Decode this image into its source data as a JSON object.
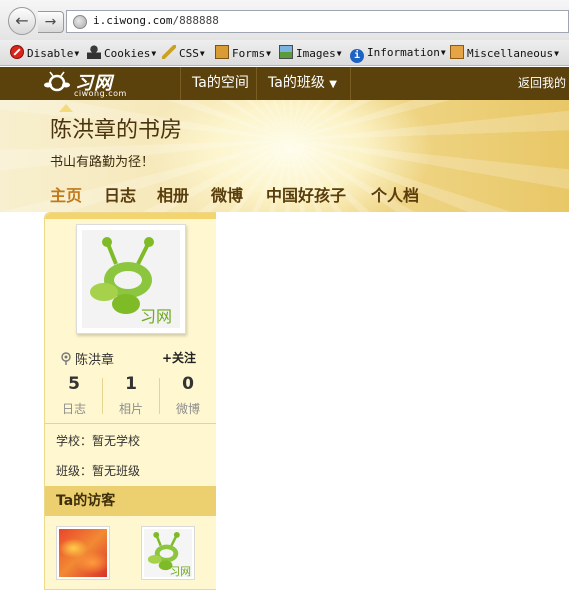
{
  "browser": {
    "url_domain": "i.ciwong.com",
    "url_path": "/888888",
    "toolbar": {
      "disable": "Disable",
      "cookies": "Cookies",
      "css": "CSS",
      "forms": "Forms",
      "images": "Images",
      "information": "Information",
      "miscellaneous": "Miscellaneous"
    }
  },
  "site": {
    "logo_text": "习网",
    "logo_sub": "ciwong.com",
    "nav": {
      "space": "Ta的空间",
      "class": "Ta的班级",
      "back": "返回我的"
    }
  },
  "blog": {
    "title": "陈洪章的书房",
    "motto": "书山有路勤为径！",
    "tabs": [
      "主页",
      "日志",
      "相册",
      "微博",
      "中国好孩子",
      "个人档"
    ]
  },
  "profile": {
    "avatar_text": "习网",
    "name": "陈洪章",
    "follow_label": "+关注",
    "stats": [
      {
        "value": "5",
        "label": "日志"
      },
      {
        "value": "1",
        "label": "相片"
      },
      {
        "value": "0",
        "label": "微博"
      }
    ],
    "school": "学校：暂无学校",
    "class": "班级：暂无班级",
    "visitors_title": "Ta的访客",
    "visitor_logo_text": "习网"
  }
}
